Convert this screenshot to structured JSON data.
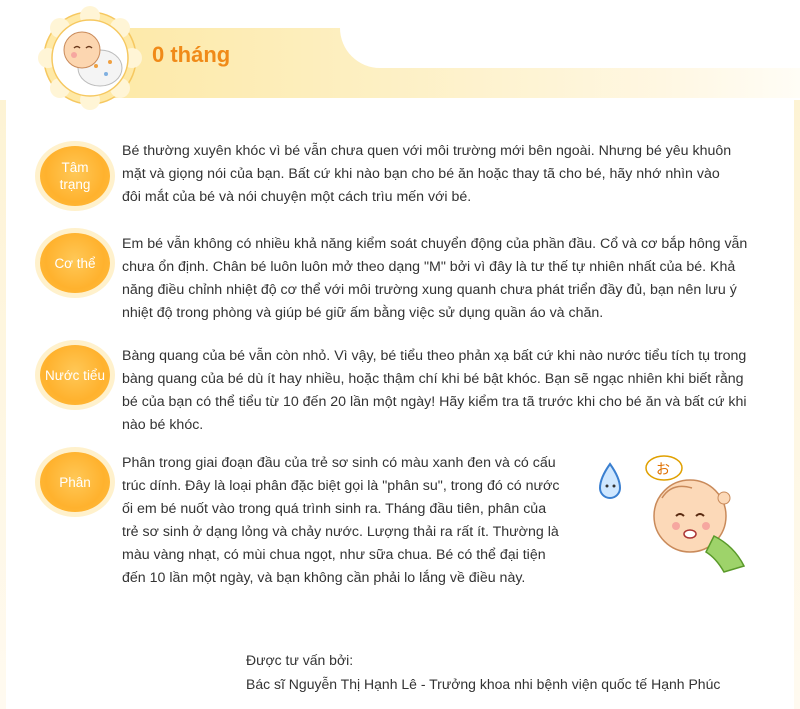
{
  "header": {
    "title": "0 tháng"
  },
  "sections": [
    {
      "label": "Tâm trạng",
      "text": "Bé thường xuyên khóc vì bé vẫn chưa quen với môi trường mới bên ngoài. Nhưng bé yêu khuôn mặt và giọng nói của bạn. Bất cứ khi nào bạn cho bé ăn hoặc thay tã cho bé, hãy nhớ nhìn vào đôi mắt của bé và nói chuyện một cách trìu mến với bé."
    },
    {
      "label": "Cơ thể",
      "text": "Em bé vẫn không có nhiều khả năng kiểm soát chuyển động của phần đầu. Cổ và cơ bắp hông vẫn chưa ổn định. Chân bé luôn luôn mở theo dạng \"M\" bởi vì đây là tư thế tự nhiên nhất của bé. Khả năng điều chỉnh nhiệt độ cơ thể với môi trường xung quanh chưa phát triển đầy đủ, bạn nên lưu ý nhiệt độ trong phòng và giúp bé giữ ấm bằng việc sử dụng quần áo và chăn."
    },
    {
      "label": "Nước tiểu",
      "text": "Bàng quang của bé vẫn còn nhỏ. Vì vậy, bé tiểu theo phản xạ bất cứ khi nào nước tiểu tích tụ trong bàng quang của bé dù ít hay nhiều, hoặc thậm chí khi bé bật khóc. Bạn sẽ ngạc nhiên khi biết rằng bé của bạn có thể tiểu từ 10 đến 20 lần một ngày! Hãy kiểm tra tã trước khi cho bé ăn và bất cứ khi nào bé khóc."
    },
    {
      "label": "Phân",
      "text": "Phân trong giai đoạn đầu của trẻ sơ sinh có màu xanh đen và có cấu trúc dính. Đây là loại phân đặc biệt gọi là \"phân su\", trong đó có nước ối em bé nuốt vào trong quá trình sinh ra. Tháng đầu tiên, phân của trẻ sơ sinh ở dạng lỏng và chảy nước. Lượng thải ra rất ít. Thường là màu vàng nhạt, có mùi chua ngọt, như sữa chua. Bé có thể đại tiện đến 10 lần một ngày, và bạn không cần phải lo lắng về điều này."
    }
  ],
  "illustration": {
    "speech_text": "お"
  },
  "credit": {
    "intro": "Được tư vấn bởi:",
    "name": "Bác sĩ Nguyễn Thị Hạnh Lê - Trưởng khoa nhi bệnh viện quốc tế Hạnh Phúc"
  },
  "colors": {
    "accent": "#f08a18",
    "pill": "#ffb22e",
    "band": "#fde9a8"
  }
}
